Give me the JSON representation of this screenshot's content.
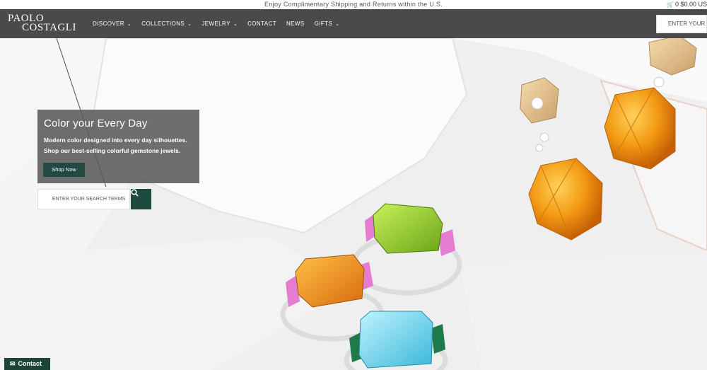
{
  "announcement": "Enjoy Complimentary Shipping and Returns within the U.S.",
  "cart": {
    "count": "0",
    "total": "$0.00 US"
  },
  "logo": {
    "line1": "PAOLO",
    "line2": "COSTAGLI"
  },
  "nav": {
    "items": [
      {
        "label": "DISCOVER",
        "dropdown": true
      },
      {
        "label": "COLLECTIONS",
        "dropdown": true
      },
      {
        "label": "JEWELRY",
        "dropdown": true
      },
      {
        "label": "CONTACT",
        "dropdown": false
      },
      {
        "label": "NEWS",
        "dropdown": false
      },
      {
        "label": "GIFTS",
        "dropdown": true
      }
    ],
    "search_placeholder": "ENTER YOUR SE"
  },
  "promo": {
    "title": "Color your Every Day",
    "subtitle": "Modern color designed into every day silhouettes. Shop our best-selling colorful gemstone jewels.",
    "button": "Shop Now"
  },
  "hero_search": {
    "placeholder": "ENTER YOUR SEARCH TERMS"
  },
  "contact_tab": {
    "label": "Contact"
  },
  "icons": {
    "cart": "cart-icon",
    "search": "search-icon",
    "envelope": "envelope-icon",
    "chevron": "chevron-down-icon"
  },
  "colors": {
    "nav_bg": "#4a4a4a",
    "accent_green": "#234a42",
    "promo_bg": "#5a5a5a"
  }
}
